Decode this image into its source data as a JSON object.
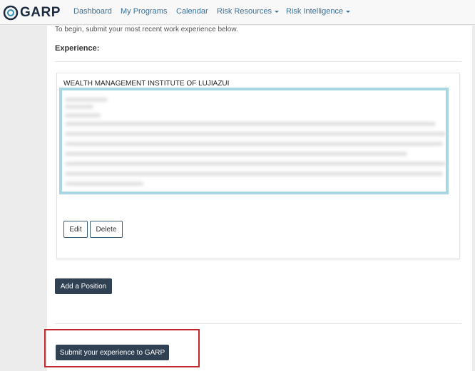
{
  "nav": {
    "brand": "GARP",
    "items": [
      {
        "label": "Dashboard",
        "dropdown": false
      },
      {
        "label": "My Programs",
        "dropdown": false
      },
      {
        "label": "Calendar",
        "dropdown": false
      },
      {
        "label": "Risk Resources",
        "dropdown": true
      },
      {
        "label": "Risk Intelligence",
        "dropdown": true
      }
    ]
  },
  "main": {
    "intro_text": "To begin, submit your most recent work experience below.",
    "section_title": "Experience:",
    "experience": {
      "company": "WEALTH MANAGEMENT INSTITUTE OF LUJIAZUI",
      "edit_label": "Edit",
      "delete_label": "Delete"
    },
    "add_position_label": "Add a Position",
    "submit_label": "Submit your experience to GARP"
  },
  "colors": {
    "nav_link": "#3a6f96",
    "dark_button": "#2f4153",
    "highlight_border": "#a7d7e3",
    "callout_border": "#c1272d"
  }
}
